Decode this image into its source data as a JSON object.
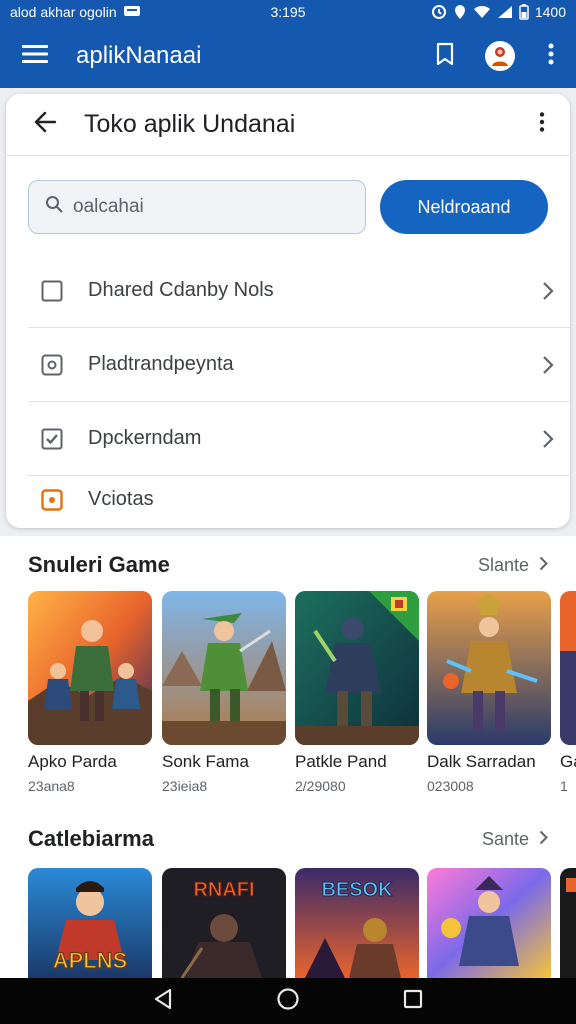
{
  "status": {
    "left_text": "alod akhar ogolin",
    "time": "3:195",
    "battery": "1400"
  },
  "app_bar": {
    "title": "aplikNanaai"
  },
  "card": {
    "title": "Toko aplik Undanai",
    "search_placeholder": "oalcahai",
    "button_label": "Neldroaand",
    "items": [
      {
        "label": "Dhared Cdanby Nols",
        "icon": "square-outline-icon"
      },
      {
        "label": "Pladtrandpeynta",
        "icon": "square-dot-icon"
      },
      {
        "label": "Dpckerndam",
        "icon": "checkbox-checked-icon"
      },
      {
        "label": "Vciotas",
        "icon": "orange-square-icon"
      }
    ]
  },
  "sections": {
    "games": {
      "title": "Snuleri Game",
      "see_all": "Slante",
      "items": [
        {
          "name": "Apko Parda",
          "meta": "23ana8"
        },
        {
          "name": "Sonk Fama",
          "meta": "23ieia8"
        },
        {
          "name": "Patkle Pand",
          "meta": "2/29080"
        },
        {
          "name": "Dalk Sarradan",
          "meta": "023008"
        },
        {
          "name": "Ga",
          "meta": "1"
        }
      ]
    },
    "collections": {
      "title": "Catlebiarma",
      "see_all": "Sante",
      "banners": [
        "APLNS",
        "RNAFI",
        "BESOK"
      ]
    }
  },
  "colors": {
    "primary": "#1558b0",
    "button": "#1565c0",
    "accent_orange": "#e8710a"
  }
}
